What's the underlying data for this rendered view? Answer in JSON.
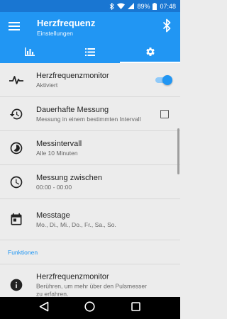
{
  "status_bar": {
    "battery_percent": "89%",
    "time": "07:48",
    "icons": [
      "bluetooth-icon",
      "wifi-icon",
      "signal-icon",
      "battery-icon"
    ]
  },
  "app_bar": {
    "title": "Herzfrequenz",
    "subtitle": "Einstellungen",
    "icons": [
      "menu-icon",
      "bluetooth-icon"
    ]
  },
  "tabs": [
    {
      "icon": "bar-chart-icon",
      "active": false
    },
    {
      "icon": "list-icon",
      "active": false
    },
    {
      "icon": "settings-icon",
      "active": true
    }
  ],
  "settings": [
    {
      "title": "Herzfrequenzmonitor",
      "subtitle": "Aktiviert",
      "icon": "heartbeat-icon",
      "control": "toggle",
      "enabled": true
    },
    {
      "title": "Dauerhafte Messung",
      "subtitle": "Messung in einem bestimmten Intervall",
      "icon": "history-icon",
      "control": "checkbox",
      "checked": false
    },
    {
      "title": "Messintervall",
      "subtitle": "Alle 10 Minuten",
      "icon": "timelapse-icon"
    },
    {
      "title": "Messung zwischen",
      "subtitle": "00:00 - 00:00",
      "icon": "clock-icon"
    },
    {
      "title": "Messtage",
      "subtitle": "Mo., Di., Mi., Do., Fr., Sa., So.",
      "icon": "calendar-icon"
    }
  ],
  "section": {
    "label": "Funktionen"
  },
  "functions": [
    {
      "title": "Herzfrequenzmonitor",
      "subtitle": "Berühren, um mehr über den Pulsmesser zu erfahren.",
      "icon": "info-icon"
    }
  ],
  "colors": {
    "primary": "#2196f3",
    "status_bar": "#1976d2",
    "background": "#ececec"
  },
  "nav_bar": {
    "icons": [
      "back-icon",
      "home-icon",
      "recents-icon"
    ]
  }
}
